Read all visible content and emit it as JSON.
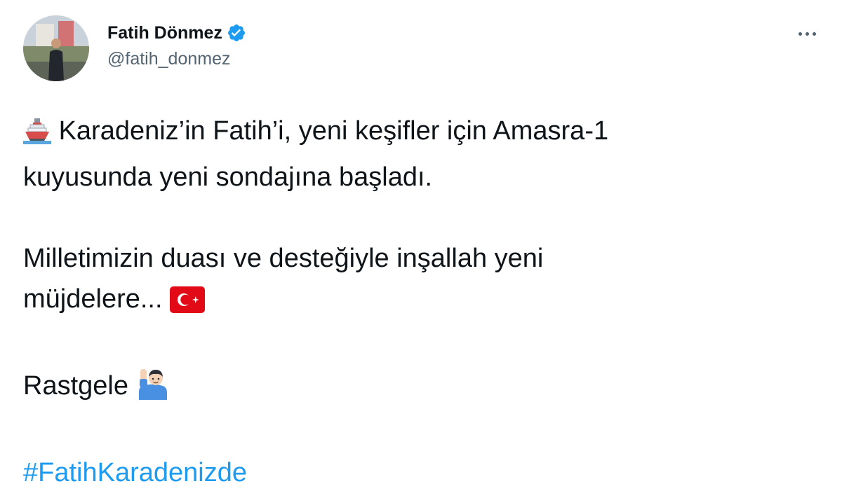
{
  "author": {
    "display_name": "Fatih Dönmez",
    "handle": "@fatih_donmez",
    "verified": true
  },
  "tweet": {
    "line1": "Karadeniz’in Fatih’i, yeni keşifler için Amasra-1",
    "line2": "kuyusunda yeni sondajına başladı.",
    "line3": "Milletimizin duası ve desteğiyle inşallah yeni",
    "line4": "müjdelere...",
    "line5": "Rastgele",
    "hashtag": "#FatihKaradenizde"
  },
  "icons": {
    "ship": "ship-emoji",
    "flag": "turkey-flag-emoji",
    "wave": "raised-hand-man-emoji",
    "verified": "verified-badge-icon",
    "more": "more-options-icon"
  },
  "colors": {
    "text": "#0f1419",
    "secondary": "#536471",
    "accent": "#1d9bf0",
    "flag_red": "#e30a17"
  }
}
